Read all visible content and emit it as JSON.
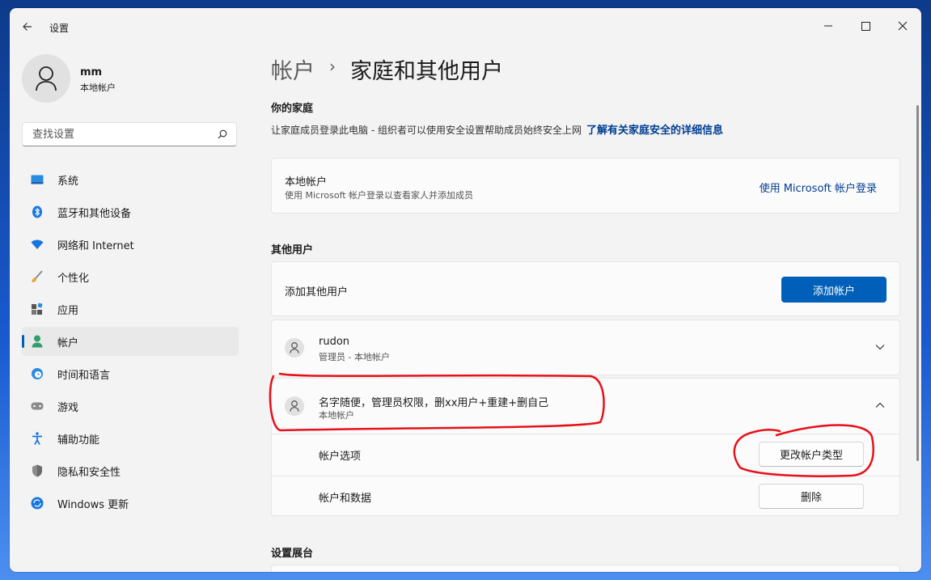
{
  "window": {
    "app_title": "设置"
  },
  "sidebar": {
    "user_name": "mm",
    "user_type": "本地帐户",
    "search_placeholder": "查找设置",
    "items": [
      {
        "label": "系统",
        "icon": "system-icon"
      },
      {
        "label": "蓝牙和其他设备",
        "icon": "bluetooth-icon"
      },
      {
        "label": "网络和 Internet",
        "icon": "wifi-icon"
      },
      {
        "label": "个性化",
        "icon": "brush-icon"
      },
      {
        "label": "应用",
        "icon": "apps-icon"
      },
      {
        "label": "帐户",
        "icon": "account-icon",
        "active": true
      },
      {
        "label": "时间和语言",
        "icon": "clock-globe-icon"
      },
      {
        "label": "游戏",
        "icon": "gamepad-icon"
      },
      {
        "label": "辅助功能",
        "icon": "accessibility-icon"
      },
      {
        "label": "隐私和安全性",
        "icon": "shield-icon"
      },
      {
        "label": "Windows 更新",
        "icon": "update-icon"
      }
    ]
  },
  "breadcrumb": {
    "parent": "帐户",
    "separator": "›",
    "current": "家庭和其他用户"
  },
  "family": {
    "title": "你的家庭",
    "description": "让家庭成员登录此电脑 - 组织者可以使用安全设置帮助成员始终安全上网",
    "link": "了解有关家庭安全的详细信息",
    "card_title": "本地帐户",
    "card_sub": "使用 Microsoft 帐户登录以查看家人并添加成员",
    "card_link": "使用 Microsoft 帐户登录"
  },
  "other_users": {
    "title": "其他用户",
    "add_label": "添加其他用户",
    "add_button": "添加帐户",
    "users": [
      {
        "name": "rudon",
        "role": "管理员 - 本地帐户",
        "expanded": false
      },
      {
        "name": "名字随便，管理员权限，删xx用户+重建+删自己",
        "role": "本地帐户",
        "expanded": true
      }
    ],
    "account_options_label": "帐户选项",
    "change_type_button": "更改帐户类型",
    "account_data_label": "帐户和数据",
    "delete_button": "删除"
  },
  "kiosk": {
    "title": "设置展台"
  },
  "colors": {
    "accent": "#005fb8",
    "link": "#003e92",
    "annotation": "#e8101a"
  }
}
